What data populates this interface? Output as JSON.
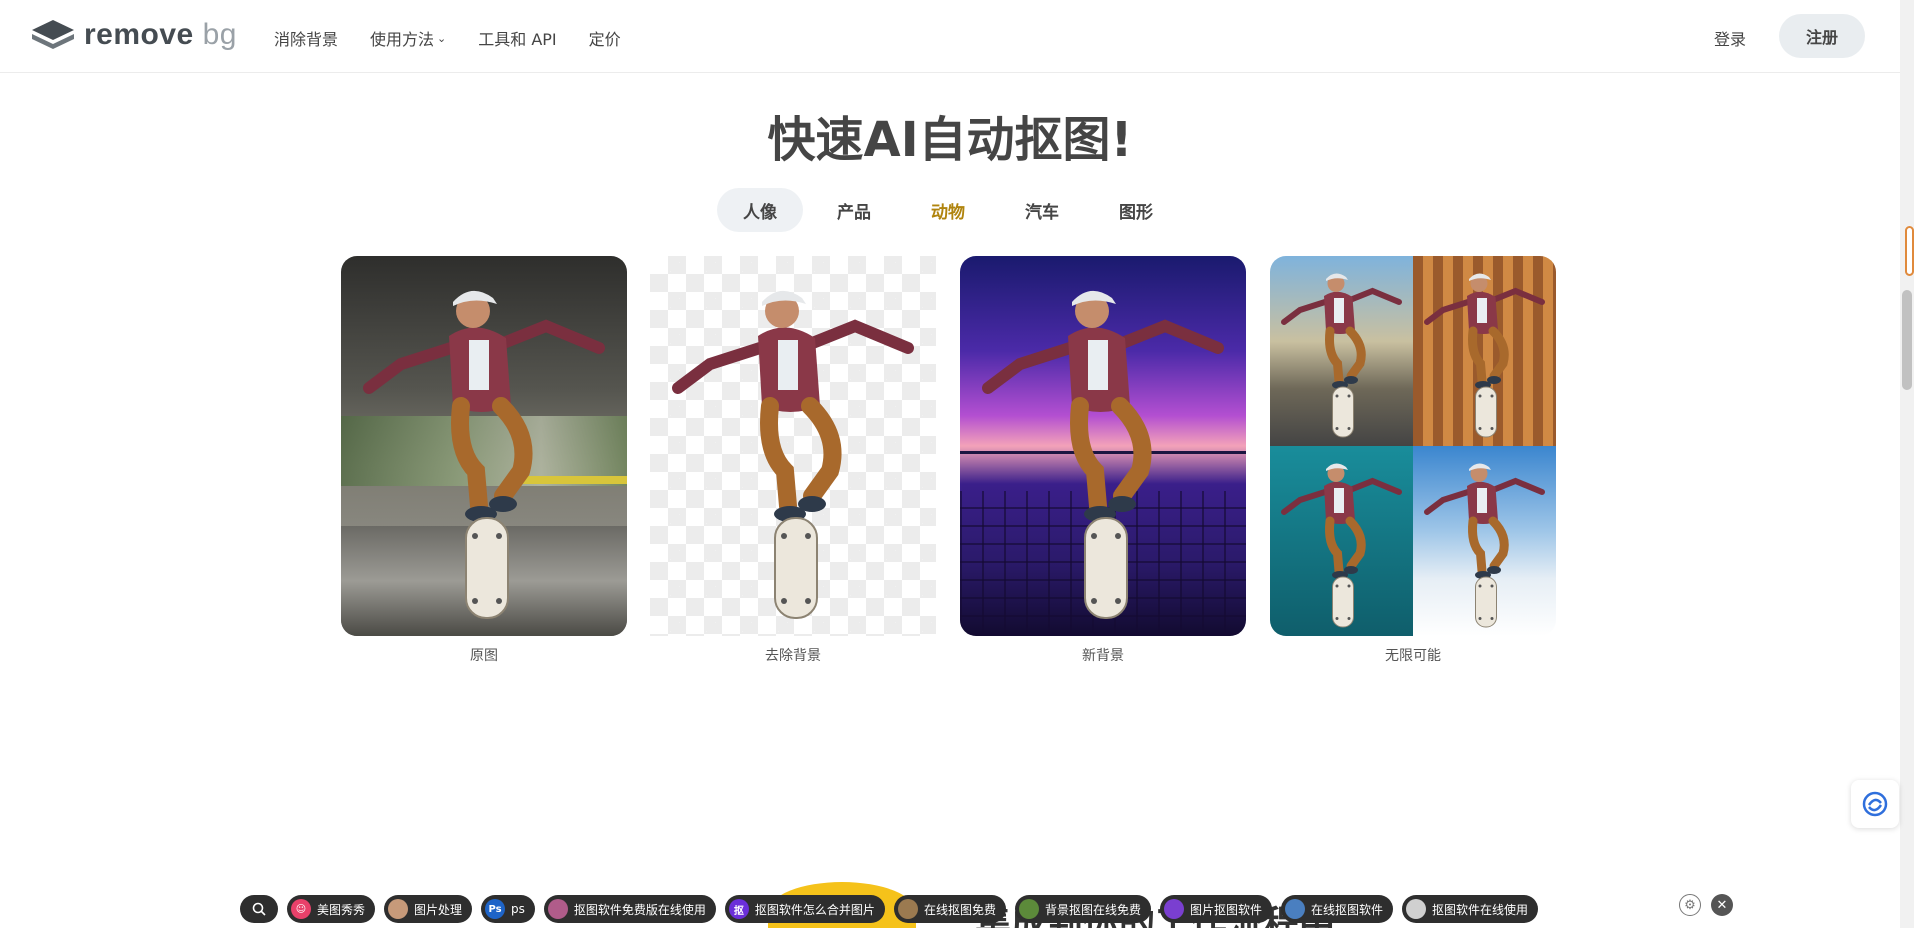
{
  "header": {
    "logo_main": "remove",
    "logo_accent": "bg",
    "nav": [
      {
        "label": "消除背景"
      },
      {
        "label": "使用方法",
        "has_dropdown": true
      },
      {
        "label": "工具和 API"
      },
      {
        "label": "定价"
      }
    ],
    "login_label": "登录",
    "signup_label": "注册"
  },
  "main": {
    "title": "快速AI自动抠图!",
    "tabs": [
      {
        "label": "人像",
        "active": true
      },
      {
        "label": "产品"
      },
      {
        "label": "动物"
      },
      {
        "label": "汽车"
      },
      {
        "label": "图形"
      }
    ],
    "cards": [
      {
        "caption": "原图"
      },
      {
        "caption": "去除背景"
      },
      {
        "caption": "新背景"
      },
      {
        "caption": "无限可能"
      }
    ],
    "peek_heading": "集成到你的工作流程中"
  },
  "bottom_bar": {
    "items": [
      {
        "label": "美图秀秀",
        "icon": "meitu-icon",
        "color": "#e8416a"
      },
      {
        "label": "图片处理",
        "icon": "avatar-icon",
        "color": "#c79a7a"
      },
      {
        "label": "ps",
        "icon": "photoshop-icon",
        "color": "#1e64c8"
      },
      {
        "label": "抠图软件免费版在线使用",
        "icon": "app-icon",
        "color": "#b05c8a"
      },
      {
        "label": "抠图软件怎么合并图片",
        "icon": "cutout-icon",
        "color": "#6b2fd9"
      },
      {
        "label": "在线抠图免费",
        "icon": "app-icon",
        "color": "#9b7a50"
      },
      {
        "label": "背景抠图在线免费",
        "icon": "app-icon",
        "color": "#5c8a3a"
      },
      {
        "label": "图片抠图软件",
        "icon": "app-icon",
        "color": "#7a3fd0"
      },
      {
        "label": "在线抠图软件",
        "icon": "app-icon",
        "color": "#4a7fc0"
      },
      {
        "label": "抠图软件在线使用",
        "icon": "app-icon",
        "color": "#d0d0d0"
      }
    ]
  },
  "colors": {
    "accent_tab": "#b0840e",
    "text": "#454545",
    "signup_bg": "#e9edf0"
  }
}
